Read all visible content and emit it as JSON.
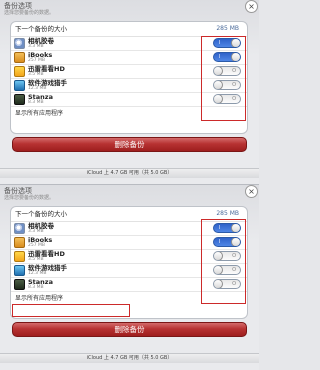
{
  "header": {
    "title": "备份选项",
    "subtitle": "选择您要备份的数据。",
    "close_symbol": "×"
  },
  "summary": {
    "label": "下一个备份的大小",
    "value": "285 MB"
  },
  "panels": [
    {
      "apps": [
        {
          "name": "相机胶卷",
          "size": "3.3 MB",
          "toggle": "I",
          "on": true
        },
        {
          "name": "iBooks",
          "size": "257 MB",
          "toggle": "I",
          "on": true
        },
        {
          "name": "迅雷看看HD",
          "size": "3.5 MB",
          "toggle": "O",
          "on": false
        },
        {
          "name": "软件游戏猎手",
          "size": "12.3 MB",
          "toggle": "O",
          "on": false
        },
        {
          "name": "Stanza",
          "size": "8.3 MB",
          "toggle": "O",
          "on": false
        }
      ],
      "show_all": "显示所有应用程序",
      "delete_label": "删除备份",
      "footer": "iCloud 上 4.7 GB 可用（共 5.0 GB）"
    },
    {
      "apps": [
        {
          "name": "相机胶卷",
          "size": "3.3 MB",
          "toggle": "I",
          "on": true
        },
        {
          "name": "iBooks",
          "size": "257 MB",
          "toggle": "I",
          "on": true
        },
        {
          "name": "迅雷看看HD",
          "size": "3.5 MB",
          "toggle": "O",
          "on": false
        },
        {
          "name": "软件游戏猎手",
          "size": "12.3 MB",
          "toggle": "O",
          "on": false
        },
        {
          "name": "Stanza",
          "size": "8.3 MB",
          "toggle": "O",
          "on": false
        }
      ],
      "show_all": "显示所有应用程序",
      "delete_label": "删除备份",
      "footer": "iCloud 上 4.7 GB 可用（共 5.0 GB）"
    }
  ],
  "colors": {
    "accent_blue": "#2f62c9",
    "highlight_red": "#cc2a2a",
    "delete_red": "#b73232"
  },
  "icons": [
    "photos-icon",
    "ibooks-icon",
    "xunlei-icon",
    "game-hunter-icon",
    "stanza-icon"
  ]
}
